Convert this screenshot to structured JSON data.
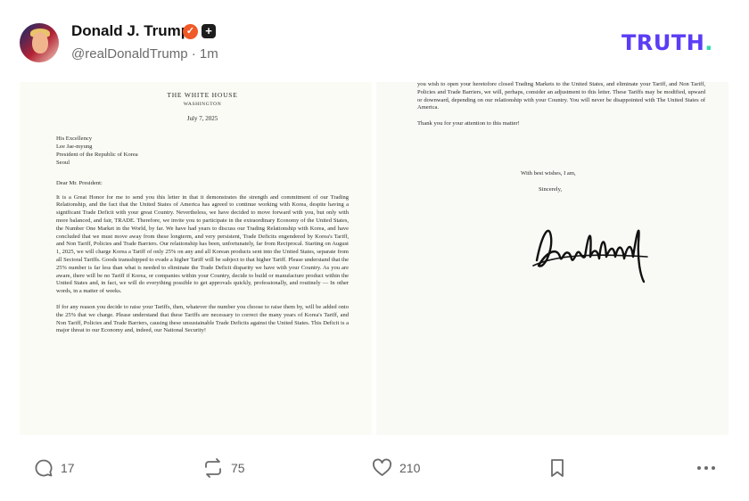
{
  "author": {
    "name": "Donald J. Trump",
    "handle": "@realDonaldTrump",
    "time": "1m"
  },
  "brand": {
    "logo_text": "TRUTH",
    "logo_dot": "."
  },
  "letter": {
    "header": "THE WHITE HOUSE",
    "city": "WASHINGTON",
    "date": "July 7, 2025",
    "address": [
      "His Excellency",
      "Lee Jae-myung",
      "President of the Republic of Korea",
      "Seoul"
    ],
    "salutation": "Dear Mr. President:",
    "paragraph1": "It is a Great Honor for me to send you this letter in that it demonstrates the strength and commitment of our Trading Relationship, and the fact that the United States of America has agreed to continue working with Korea, despite having a significant Trade Deficit with your great Country. Nevertheless, we have decided to move forward with you, but only with more balanced, and fair, TRADE. Therefore, we invite you to participate in the extraordinary Economy of the United States, the Number One Market in the World, by far. We have had years to discuss our Trading Relationship with Korea, and have concluded that we must move away from these longterm, and very persistent, Trade Deficits engendered by Korea's Tariff, and Non Tariff, Policies and Trade Barriers. Our relationship has been, unfortunately, far from Reciprocal. Starting on August 1, 2025, we will charge Korea a Tariff of only 25% on any and all Korean products sent into the United States, separate from all Sectoral Tariffs. Goods transshipped to evade a higher Tariff will be subject to that higher Tariff. Please understand that the 25% number is far less than what is needed to eliminate the Trade Deficit disparity we have with your Country. As you are aware, there will be no Tariff if Korea, or companies within your Country, decide to build or manufacture product within the United States and, in fact, we will do everything possible to get approvals quickly, professionally, and routinely — In other words, in a matter of weeks.",
    "paragraph2": "If for any reason you decide to raise your Tariffs, then, whatever the number you choose to raise them by, will be added onto the 25% that we charge. Please understand that these Tariffs are necessary to correct the many years of Korea's Tariff, and Non Tariff, Policies and Trade Barriers, causing these unsustainable Trade Deficits against the United States. This Deficit is a major threat to our Economy and, indeed, our National Security!",
    "page2_paragraph": "you wish to open your heretofore closed Trading Markets to the United States, and eliminate your Tariff, and Non Tariff, Policies and Trade Barriers, we will, perhaps, consider an adjustment to this letter. These Tariffs may be modified, upward or downward, depending on our relationship with your Country. You will never be disappointed with The United States of America.",
    "thanks": "Thank you for your attention to this matter!",
    "closing": "With best wishes, I am,",
    "sincerely": "Sincerely,"
  },
  "actions": {
    "replies": "17",
    "retruths": "75",
    "likes": "210"
  },
  "icons": [
    "verified-badge-icon",
    "subscribe-plus-icon",
    "reply-icon",
    "retruth-icon",
    "like-icon",
    "bookmark-icon",
    "more-icon"
  ],
  "colors": {
    "brand_purple": "#5b3df5",
    "brand_teal": "#32d8b1",
    "verified_orange": "#f05a28"
  }
}
